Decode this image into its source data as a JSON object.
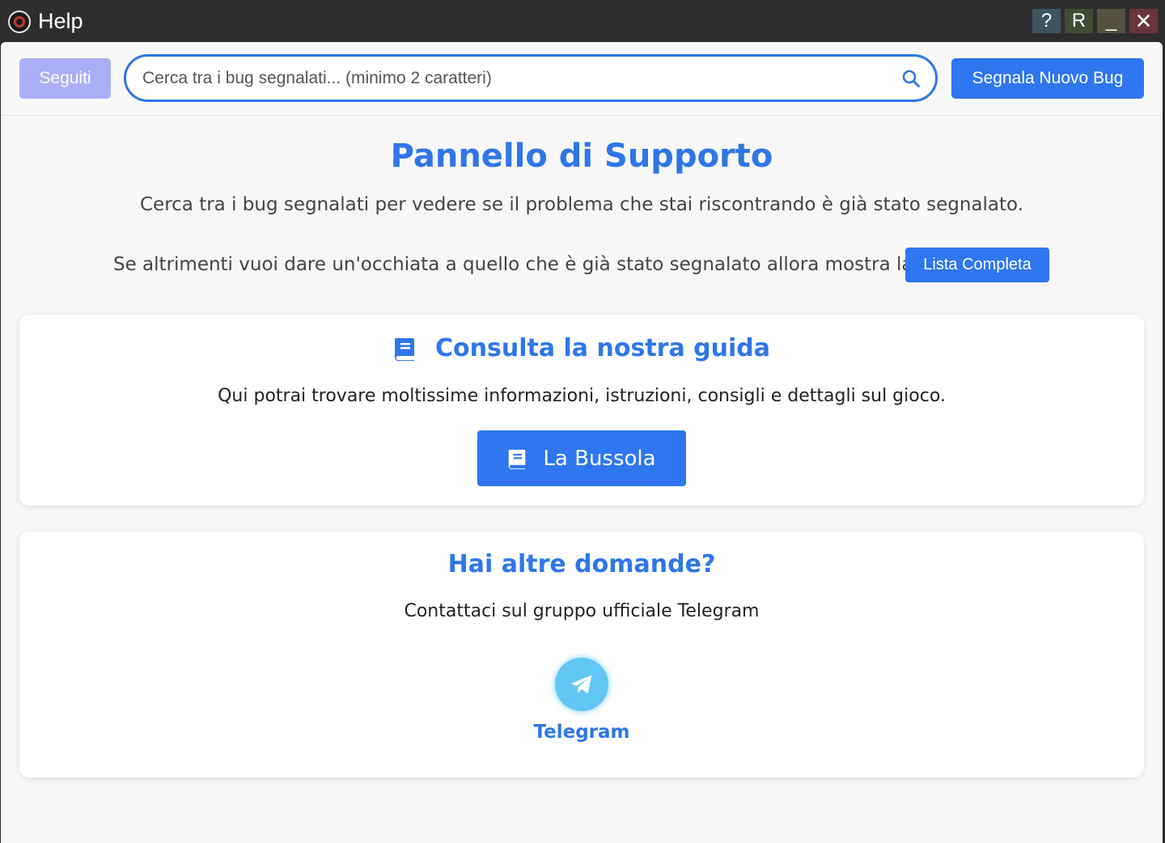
{
  "window": {
    "title": "Help",
    "controls": {
      "help": "?",
      "r": "R",
      "minimize": "_",
      "close": "✕"
    }
  },
  "header": {
    "followed_label": "Seguiti",
    "search_placeholder": "Cerca tra i bug segnalati... (minimo 2 caratteri)",
    "report_label": "Segnala Nuovo Bug"
  },
  "main": {
    "title": "Pannello di Supporto",
    "subtitle": "Cerca tra i bug segnalati per vedere se il problema che stai riscontrando è già stato segnalato.",
    "full_list_text": "Se altrimenti vuoi dare un'occhiata a quello che è già stato segnalato allora mostra la",
    "full_list_button": "Lista Completa"
  },
  "guide": {
    "title": "Consulta la nostra guida",
    "text": "Qui potrai trovare moltissime informazioni, istruzioni, consigli e dettagli sul gioco.",
    "button": "La Bussola"
  },
  "contact": {
    "title": "Hai altre domande?",
    "text": "Contattaci sul gruppo ufficiale Telegram",
    "link_label": "Telegram"
  },
  "colors": {
    "accent": "#2f76e8",
    "button": "#2f76f0",
    "followed_button": "#abaff8",
    "telegram": "#62c7f4"
  }
}
